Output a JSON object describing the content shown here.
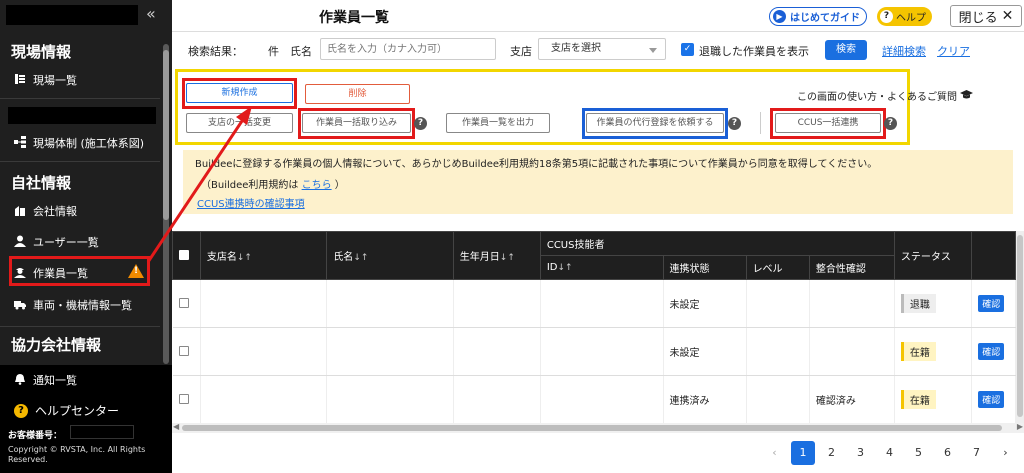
{
  "sidebar": {
    "collapse_icon": "«",
    "sections": {
      "genba": "現場情報",
      "jisha": "自社情報",
      "kyoryoku": "協力会社情報"
    },
    "items": {
      "genba_list": "現場一覧",
      "genba_taisei": "現場体制 (施工体系図)",
      "company_info": "会社情報",
      "user_list": "ユーザー一覧",
      "worker_list": "作業員一覧",
      "vehicle_list": "車両・機械情報一覧",
      "notice_list": "通知一覧",
      "help_center": "ヘルプセンター"
    },
    "customer_label": "お客様番号：",
    "copyright": "Copyright © RVSTA, Inc. All Rights Reserved."
  },
  "header": {
    "title": "作業員一覧",
    "guide_label": "はじめてガイド",
    "help_label": "ヘルプ",
    "close_label": "閉じる"
  },
  "search": {
    "results_label": "検索結果：",
    "unit": "件",
    "name_label": "氏名",
    "name_placeholder": "氏名を入力（カナ入力可）",
    "branch_label": "支店",
    "branch_placeholder": "支店を選択",
    "retired_label": "退職した作業員を表示",
    "search_button": "検索",
    "detail_link": "詳細検索",
    "clear_link": "クリア"
  },
  "actions": {
    "new": "新規作成",
    "delete": "削除",
    "branch_bulk": "支店の一括変更",
    "bulk_import": "作業員一括取り込み",
    "export": "作業員一覧を出力",
    "proxy_register": "作業員の代行登録を依頼する",
    "ccus_bulk": "CCUS一括連携",
    "howto": "この画面の使い方・よくあるご質問"
  },
  "notice": {
    "line1": "Buildeeに登録する作業員の個人情報について、あらかじめBuildee利用規約18条第5項に記載された事項について作業員から同意を取得してください。",
    "line2_prefix": "（Buildee利用規約は",
    "line2_link": "こちら",
    "line2_suffix": "）",
    "line3_link": "CCUS連携時の確認事項"
  },
  "table": {
    "headers": {
      "branch": "支店名",
      "name": "氏名",
      "birthday": "生年月日",
      "ccus": "CCUS技能者",
      "id": "ID",
      "link_status": "連携状態",
      "level": "レベル",
      "consistency": "整合性確認",
      "status": "ステータス"
    },
    "sort_icon": "↓↑",
    "rows": [
      {
        "link_status": "未設定",
        "consistency": "",
        "status": "退職",
        "action": "確認"
      },
      {
        "link_status": "未設定",
        "consistency": "",
        "status": "在籍",
        "action": "確認"
      },
      {
        "link_status": "連携済み",
        "consistency": "確認済み",
        "status": "在籍",
        "action": "確認"
      }
    ]
  },
  "pagination": {
    "prev": "‹",
    "pages": [
      "1",
      "2",
      "3",
      "4",
      "5",
      "6",
      "7"
    ],
    "next": "›"
  },
  "colors": {
    "sidebar_bg": "#1f1f1f",
    "accent": "#1a6fe0",
    "highlight_red": "#e21a1a",
    "highlight_yellow": "#f2d600",
    "highlight_blue": "#1a5fd6",
    "notice_bg": "#fdf1cc"
  },
  "icons": {
    "sidebar": [
      "list-icon",
      "hierarchy-icon",
      "building-icon",
      "user-icon",
      "worker-icon",
      "truck-icon",
      "bell-icon",
      "help-icon",
      "warning-icon"
    ],
    "header": [
      "guide-icon",
      "help-icon",
      "close-icon"
    ],
    "actions": [
      "question-icon",
      "graduation-cap-icon"
    ]
  }
}
